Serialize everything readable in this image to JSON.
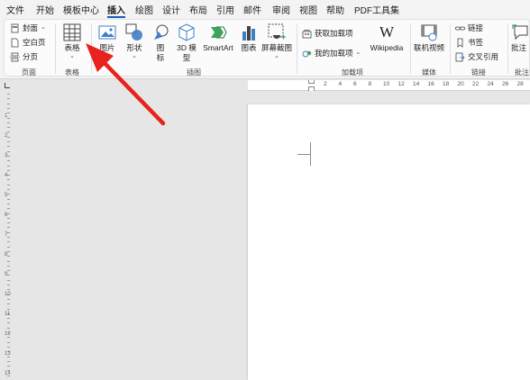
{
  "menu": {
    "tabs": [
      "文件",
      "开始",
      "模板中心",
      "插入",
      "绘图",
      "设计",
      "布局",
      "引用",
      "邮件",
      "审阅",
      "视图",
      "帮助",
      "PDF工具集"
    ],
    "active": "插入"
  },
  "groups": {
    "pages": {
      "label": "页面",
      "cover": "封面",
      "cover_caret": "⌄",
      "blank": "空白页",
      "break": "分页"
    },
    "tables": {
      "label": "表格",
      "table": "表格",
      "table_caret": "⌄"
    },
    "illustrations": {
      "label": "插图",
      "picture": "图片",
      "shapes": "形状",
      "icons_line1": "图",
      "icons_line2": "标",
      "model3d_line1": "3D 模",
      "model3d_line2": "型",
      "smartart": "SmartArt",
      "chart": "图表",
      "screenshot": "屏幕截图",
      "caret": "⌄"
    },
    "addins": {
      "label": "加载项",
      "get": "获取加载项",
      "mine": "我的加载项",
      "wikipedia": "Wikipedia",
      "wiki_glyph": "W",
      "caret": "⌄"
    },
    "media": {
      "label": "媒体",
      "video": "联机视频"
    },
    "links": {
      "label": "链接",
      "link": "链接",
      "bookmark": "书签",
      "crossref": "交叉引用"
    },
    "comments": {
      "label": "批注",
      "comment": "批注"
    }
  },
  "ruler": {
    "marks": [
      "2",
      "4",
      "6",
      "8",
      "10",
      "12",
      "14",
      "16",
      "18",
      "20",
      "22",
      "24",
      "26",
      "28",
      "30"
    ],
    "vmarks": [
      "1",
      "2",
      "3",
      "4",
      "5",
      "6",
      "7",
      "8",
      "9",
      "10",
      "11",
      "12",
      "13",
      "14"
    ]
  },
  "colors": {
    "accent": "#185abd",
    "arrow": "#e8221d"
  }
}
